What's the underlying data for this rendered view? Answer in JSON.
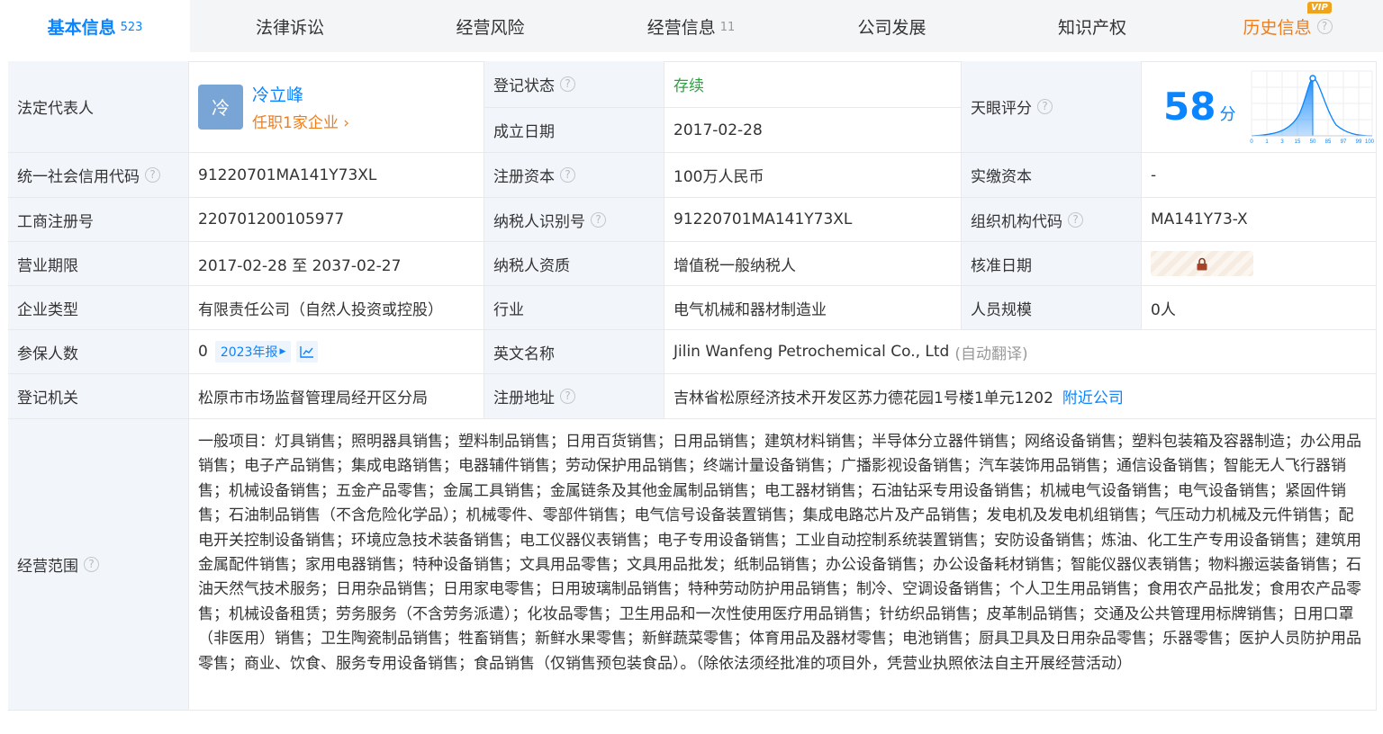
{
  "tabs": [
    {
      "label": "基本信息",
      "count": "523"
    },
    {
      "label": "法律诉讼",
      "count": ""
    },
    {
      "label": "经营风险",
      "count": ""
    },
    {
      "label": "经营信息",
      "count": "11"
    },
    {
      "label": "公司发展",
      "count": ""
    },
    {
      "label": "知识产权",
      "count": ""
    },
    {
      "label": "历史信息",
      "count": "",
      "badge": "VIP"
    }
  ],
  "labels": {
    "legal_rep": "法定代表人",
    "reg_status": "登记状态",
    "founded": "成立日期",
    "tianyan_score": "天眼评分",
    "credit_code": "统一社会信用代码",
    "reg_capital": "注册资本",
    "paid_capital": "实缴资本",
    "biz_reg_no": "工商注册号",
    "taxpayer_id": "纳税人识别号",
    "org_code": "组织机构代码",
    "biz_term": "营业期限",
    "taxpayer_qual": "纳税人资质",
    "approval_date": "核准日期",
    "company_type": "企业类型",
    "industry": "行业",
    "staff_size": "人员规模",
    "insured": "参保人数",
    "english_name": "英文名称",
    "reg_authority": "登记机关",
    "reg_address": "注册地址",
    "biz_scope": "经营范围"
  },
  "values": {
    "avatar_char": "冷",
    "legal_rep_name": "冷立峰",
    "legal_rep_sub": "任职1家企业",
    "reg_status": "存续",
    "founded": "2017-02-28",
    "score": "58",
    "score_unit": "分",
    "credit_code": "91220701MA141Y73XL",
    "reg_capital": "100万人民币",
    "paid_capital": "-",
    "biz_reg_no": "220701200105977",
    "taxpayer_id": "91220701MA141Y73XL",
    "org_code": "MA141Y73-X",
    "biz_term": "2017-02-28 至 2037-02-27",
    "taxpayer_qual": "增值税一般纳税人",
    "company_type": "有限责任公司（自然人投资或控股）",
    "industry": "电气机械和器材制造业",
    "staff_size": "0人",
    "insured": "0",
    "insured_year": "2023年报",
    "english_name": "Jilin Wanfeng Petrochemical Co., Ltd",
    "english_name_note": "(自动翻译)",
    "reg_authority": "松原市市场监督管理局经开区分局",
    "reg_address": "吉林省松原经济技术开发区苏力德花园1号楼1单元1202",
    "nearby": "附近公司",
    "biz_scope": "一般项目：灯具销售；照明器具销售；塑料制品销售；日用百货销售；日用品销售；建筑材料销售；半导体分立器件销售；网络设备销售；塑料包装箱及容器制造；办公用品销售；电子产品销售；集成电路销售；电器辅件销售；劳动保护用品销售；终端计量设备销售；广播影视设备销售；汽车装饰用品销售；通信设备销售；智能无人飞行器销售；机械设备销售；五金产品零售；金属工具销售；金属链条及其他金属制品销售；电工器材销售；石油钻采专用设备销售；机械电气设备销售；电气设备销售；紧固件销售；石油制品销售（不含危险化学品）；机械零件、零部件销售；电气信号设备装置销售；集成电路芯片及产品销售；发电机及发电机组销售；气压动力机械及元件销售；配电开关控制设备销售；环境应急技术装备销售；电工仪器仪表销售；电子专用设备销售；工业自动控制系统装置销售；安防设备销售；炼油、化工生产专用设备销售；建筑用金属配件销售；家用电器销售；特种设备销售；文具用品零售；文具用品批发；纸制品销售；办公设备销售；办公设备耗材销售；智能仪器仪表销售；物料搬运装备销售；石油天然气技术服务；日用杂品销售；日用家电零售；日用玻璃制品销售；特种劳动防护用品销售；制冷、空调设备销售；个人卫生用品销售；食用农产品批发；食用农产品零售；机械设备租赁；劳务服务（不含劳务派遣）；化妆品零售；卫生用品和一次性使用医疗用品销售；针纺织品销售；皮革制品销售；交通及公共管理用标牌销售；日用口罩（非医用）销售；卫生陶瓷制品销售；牲畜销售；新鲜水果零售；新鲜蔬菜零售；体育用品及器材零售；电池销售；厨具卫具及日用杂品零售；乐器零售；医护人员防护用品零售；商业、饮食、服务专用设备销售；食品销售（仅销售预包装食品）。（除依法须经批准的项目外，凭营业执照依法自主开展经营活动）"
  },
  "score_chart": {
    "ticks": [
      "0",
      "1",
      "3",
      "15",
      "50",
      "85",
      "97",
      "99",
      "100"
    ]
  },
  "colors": {
    "accent": "#0a84ff",
    "orange": "#f07d1a",
    "green": "#2ea043",
    "label_bg": "#f2f6fb"
  }
}
